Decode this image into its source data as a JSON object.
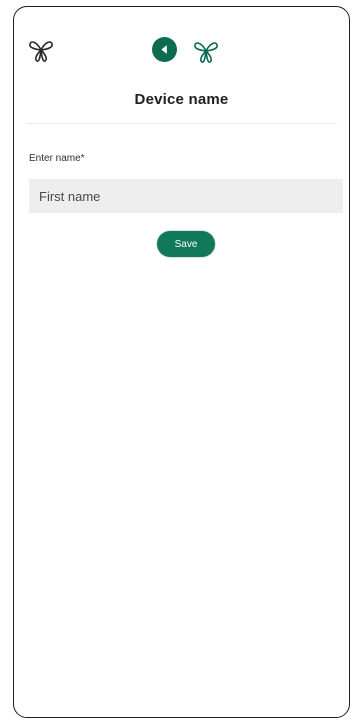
{
  "header": {
    "left_icon": "butterfly-logo-icon",
    "back_icon": "back-arrow-icon",
    "center_icon": "butterfly-logo-icon"
  },
  "page": {
    "title": "Device name"
  },
  "form": {
    "label": "Enter name*",
    "input_value": "",
    "input_placeholder": "First name",
    "save_label": "Save"
  },
  "colors": {
    "accent": "#11795a",
    "back_button": "#0d6b50",
    "input_background": "#eeeeee"
  }
}
